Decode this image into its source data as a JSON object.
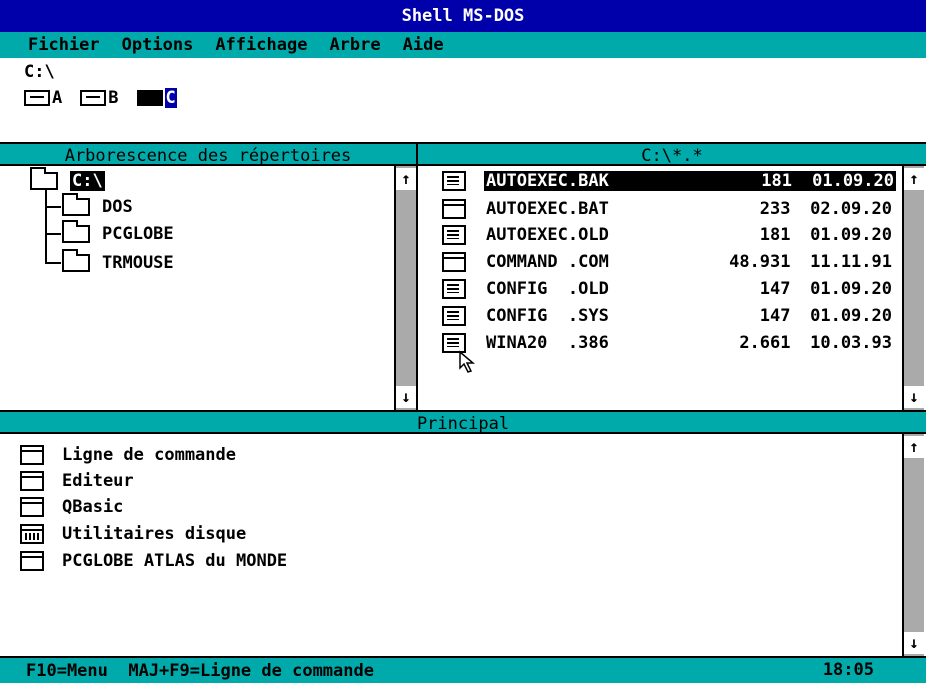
{
  "window": {
    "title": "Shell MS-DOS"
  },
  "menu": [
    "Fichier",
    "Options",
    "Affichage",
    "Arbre",
    "Aide"
  ],
  "drive_bar": {
    "current_path": "C:\\",
    "drives": [
      {
        "letter": "A",
        "selected": false
      },
      {
        "letter": "B",
        "selected": false
      },
      {
        "letter": "C",
        "selected": true
      }
    ]
  },
  "tree_panel": {
    "title": "Arborescence des répertoires",
    "root": "C:\\",
    "folders": [
      "DOS",
      "PCGLOBE",
      "TRMOUSE"
    ]
  },
  "files_panel": {
    "title": "C:\\*.*",
    "files": [
      {
        "name": "AUTOEXEC.BAK",
        "size": "181",
        "date": "01.09.20",
        "icon": "doc-icon",
        "selected": true
      },
      {
        "name": "AUTOEXEC.BAT",
        "size": "233",
        "date": "02.09.20",
        "icon": "program-icon",
        "selected": false
      },
      {
        "name": "AUTOEXEC.OLD",
        "size": "181",
        "date": "01.09.20",
        "icon": "doc-icon",
        "selected": false
      },
      {
        "name": "COMMAND .COM",
        "size": "48.931",
        "date": "11.11.91",
        "icon": "program-icon",
        "selected": false
      },
      {
        "name": "CONFIG  .OLD",
        "size": "147",
        "date": "01.09.20",
        "icon": "doc-icon",
        "selected": false
      },
      {
        "name": "CONFIG  .SYS",
        "size": "147",
        "date": "01.09.20",
        "icon": "doc-icon",
        "selected": false
      },
      {
        "name": "WINA20  .386",
        "size": "2.661",
        "date": "10.03.93",
        "icon": "doc-icon",
        "selected": false
      }
    ]
  },
  "main_panel": {
    "title": "Principal",
    "programs": [
      {
        "label": "Ligne de commande",
        "icon": "program-icon"
      },
      {
        "label": "Editeur",
        "icon": "program-icon"
      },
      {
        "label": "QBasic",
        "icon": "program-icon"
      },
      {
        "label": "Utilitaires disque",
        "icon": "group-icon"
      },
      {
        "label": "PCGLOBE ATLAS du MONDE",
        "icon": "program-icon"
      }
    ]
  },
  "status_bar": {
    "help": "F10=Menu  MAJ+F9=Ligne de commande",
    "time": "18:05"
  },
  "scroll": {
    "up": "↑",
    "down": "↓"
  },
  "colors": {
    "title_bg": "#0000aa",
    "accent": "#00aaaa",
    "scroll_track": "#aaaaaa"
  }
}
